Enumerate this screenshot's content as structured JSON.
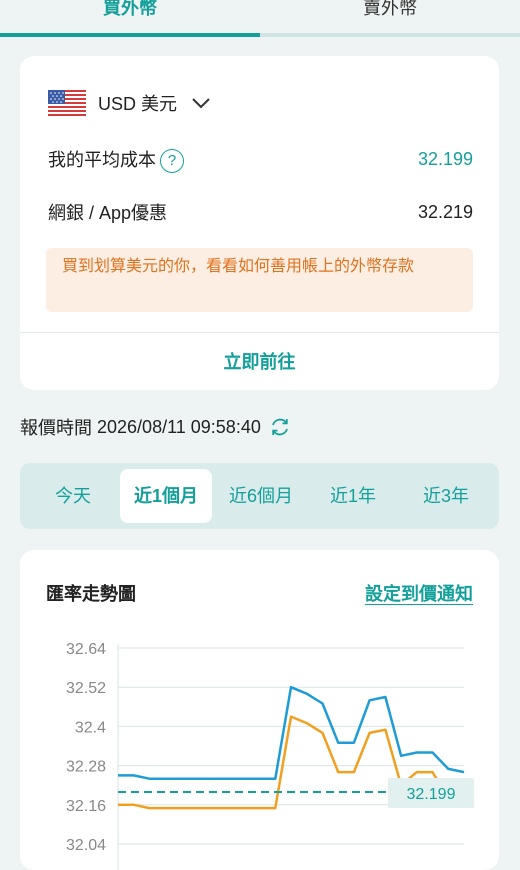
{
  "tabs": {
    "buy": "買外幣",
    "sell": "賣外幣"
  },
  "currency": {
    "flag_icon": "us-flag-icon",
    "label": "USD 美元",
    "avg_cost_label": "我的平均成本",
    "avg_cost_value": "32.199",
    "web_app_label": "網銀 / App優惠",
    "web_app_value": "32.219",
    "promo_text": "買到划算美元的你，看看如何善用帳上的外幣存款",
    "go_button": "立即前往"
  },
  "quote": {
    "label": "報價時間",
    "time": "2026/08/11 09:58:40"
  },
  "periods": [
    "今天",
    "近1個月",
    "近6個月",
    "近1年",
    "近3年"
  ],
  "selected_period": "近1個月",
  "chart": {
    "title": "匯率走勢圖",
    "alert_link": "設定到價通知",
    "avg_label": "32.199"
  },
  "chart_data": {
    "type": "line",
    "y_ticks": [
      "32.64",
      "32.52",
      "32.4",
      "32.28",
      "32.16",
      "32.04"
    ],
    "ylim": [
      32.04,
      32.64
    ],
    "x": [
      0,
      1,
      2,
      3,
      4,
      5,
      6,
      7,
      8,
      9,
      10,
      11,
      12,
      13,
      14,
      15,
      16,
      17,
      18,
      19,
      20,
      21,
      22
    ],
    "series": [
      {
        "color": "#1f9bd6",
        "values": [
          32.25,
          32.25,
          32.24,
          32.24,
          32.24,
          32.24,
          32.24,
          32.24,
          32.24,
          32.24,
          32.24,
          32.52,
          32.5,
          32.47,
          32.35,
          32.35,
          32.48,
          32.49,
          32.31,
          32.32,
          32.32,
          32.27,
          32.26
        ]
      },
      {
        "color": "#f0a020",
        "values": [
          32.16,
          32.16,
          32.15,
          32.15,
          32.15,
          32.15,
          32.15,
          32.15,
          32.15,
          32.15,
          32.15,
          32.43,
          32.41,
          32.38,
          32.26,
          32.26,
          32.38,
          32.39,
          32.22,
          32.26,
          32.26,
          32.18,
          32.17
        ]
      }
    ],
    "reference_line": {
      "value": 32.199,
      "color": "#14a09a",
      "style": "dashed"
    }
  }
}
